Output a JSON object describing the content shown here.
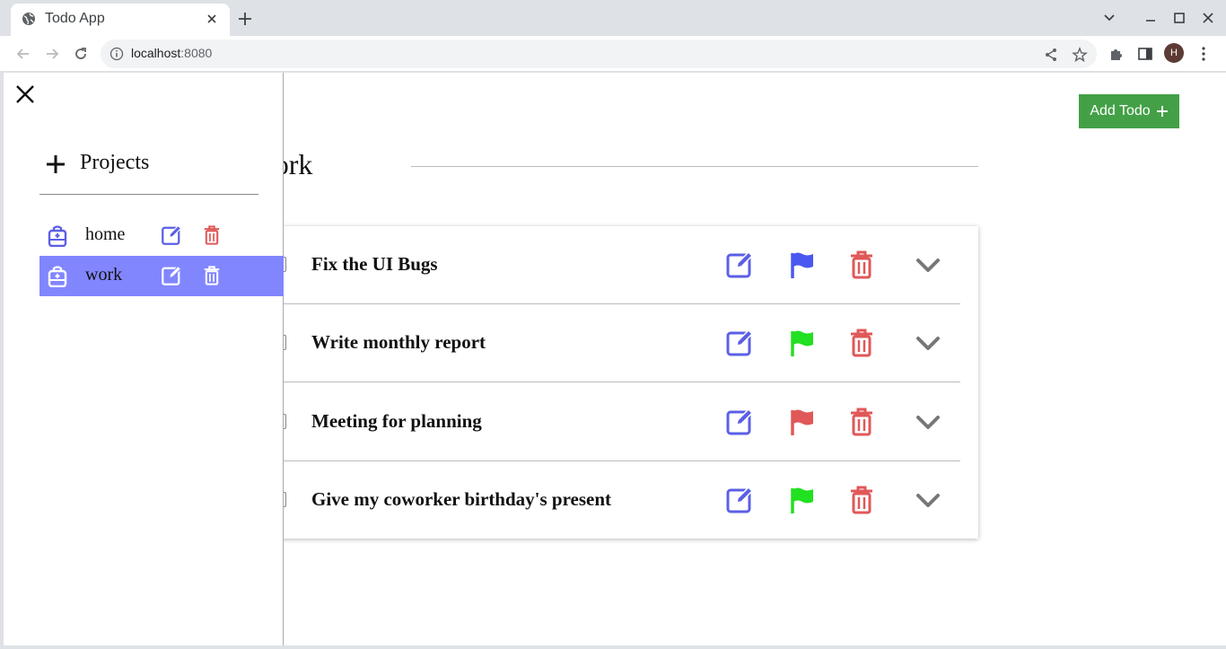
{
  "browser": {
    "tab_title": "Todo App",
    "url_host": "localhost",
    "url_port": ":8080",
    "avatar_initial": "H"
  },
  "page": {
    "add_todo_label": "Add Todo",
    "project_heading": "Project work"
  },
  "sidebar": {
    "header_label": "Projects",
    "projects": [
      {
        "name": "home",
        "active": false
      },
      {
        "name": "work",
        "active": true
      }
    ]
  },
  "todos": [
    {
      "title": "Fix the UI Bugs",
      "priority_color": "#4a57f0"
    },
    {
      "title": "Write monthly report",
      "priority_color": "#22e022"
    },
    {
      "title": "Meeting for planning",
      "priority_color": "#e05858"
    },
    {
      "title": "Give my coworker birthday's present",
      "priority_color": "#22e022"
    }
  ],
  "colors": {
    "accent": "#5b5fe6",
    "danger": "#e05858",
    "add_button": "#43a047",
    "active_project": "#8186ff"
  }
}
